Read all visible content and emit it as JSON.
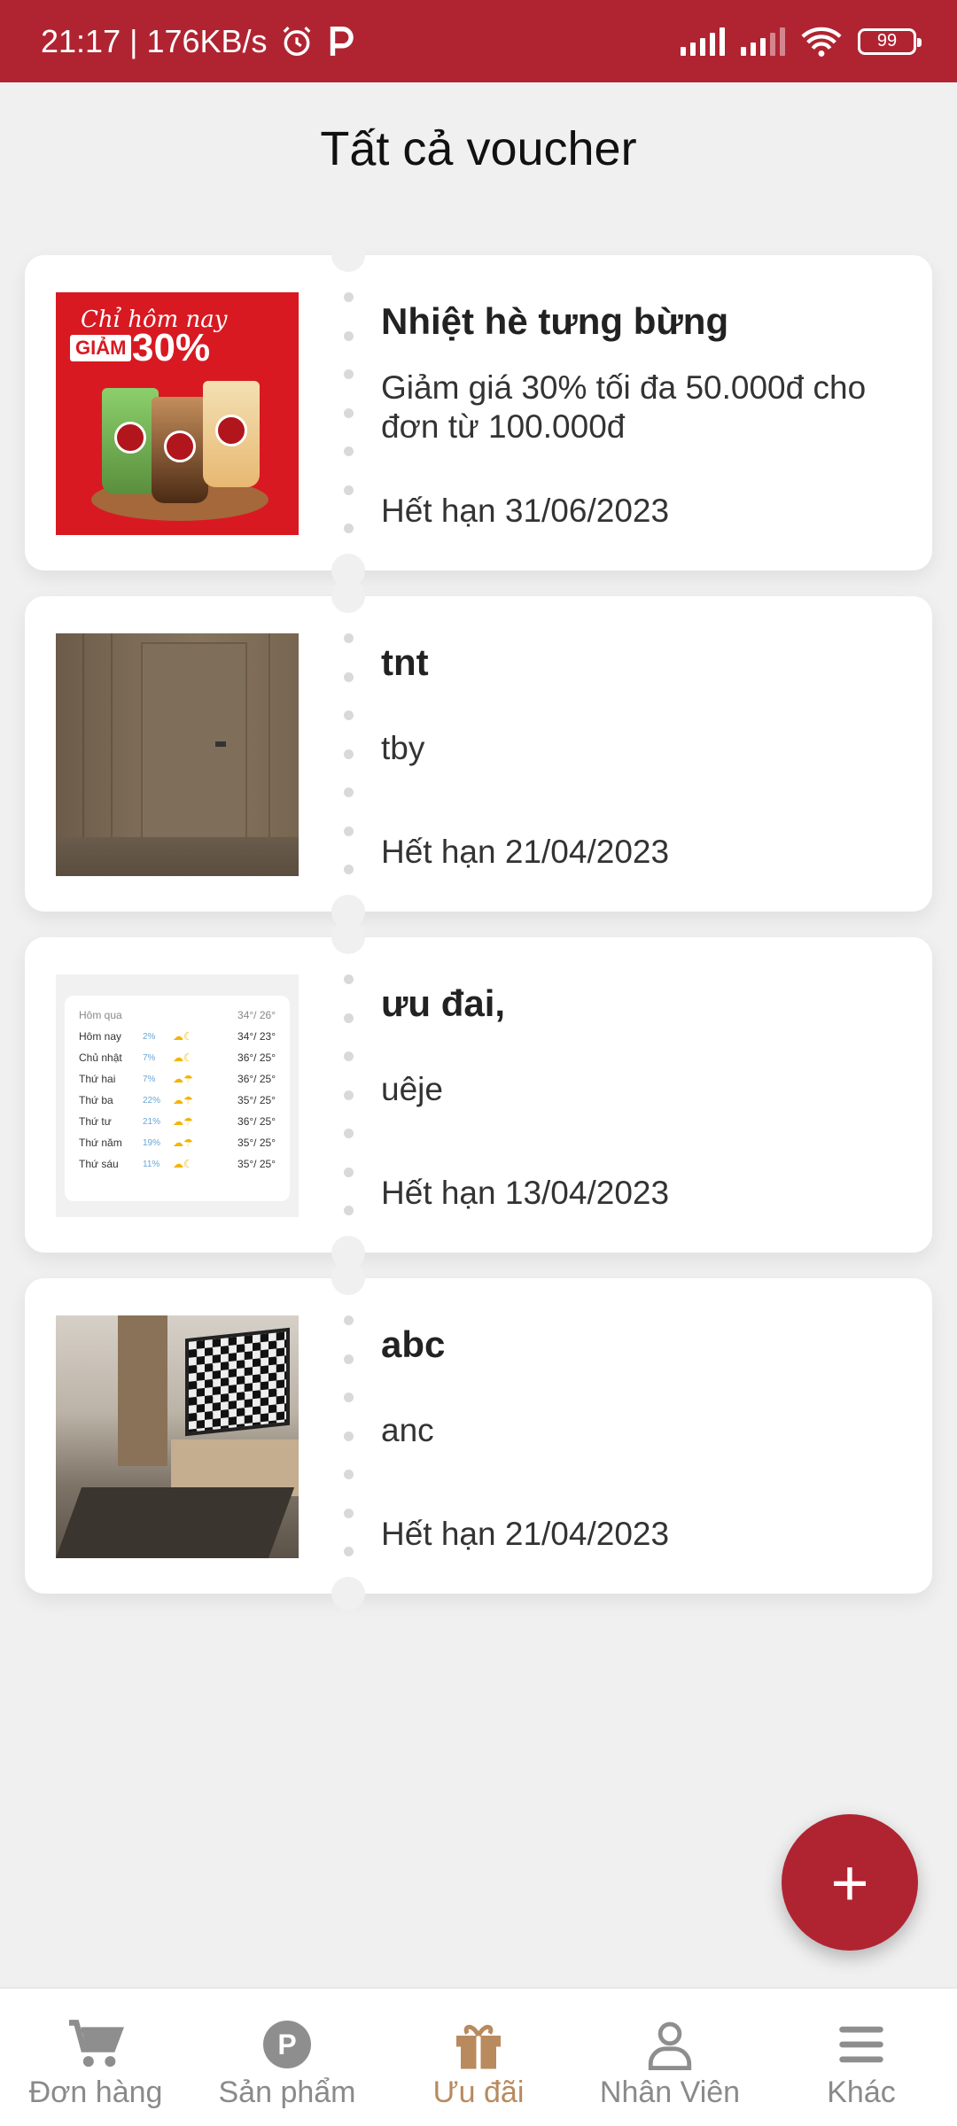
{
  "status_bar": {
    "time_speed": "21:17 | 176KB/s",
    "battery": "99"
  },
  "page": {
    "title": "Tất cả voucher"
  },
  "vouchers": [
    {
      "title": "Nhiệt hè tưng bừng",
      "description": "Giảm giá 30% tối đa 50.000đ cho đơn từ 100.000đ",
      "expiry": "Hết hạn 31/06/2023",
      "image_text": {
        "line1": "Chỉ hôm nay",
        "badge": "GIẢM",
        "percent": "30%"
      }
    },
    {
      "title": "tnt",
      "description": "tby",
      "expiry": "Hết hạn 21/04/2023"
    },
    {
      "title": "ưu đai,",
      "description": "uêje",
      "expiry": "Hết hạn 13/04/2023",
      "image_rows": [
        {
          "day": "Hôm qua",
          "pct": "",
          "temp": "34°/ 26°"
        },
        {
          "day": "Hôm nay",
          "pct": "2%",
          "temp": "34°/ 23°"
        },
        {
          "day": "Chủ nhật",
          "pct": "7%",
          "temp": "36°/ 25°"
        },
        {
          "day": "Thứ hai",
          "pct": "7%",
          "temp": "36°/ 25°"
        },
        {
          "day": "Thứ ba",
          "pct": "22%",
          "temp": "35°/ 25°"
        },
        {
          "day": "Thứ tư",
          "pct": "21%",
          "temp": "36°/ 25°"
        },
        {
          "day": "Thứ năm",
          "pct": "19%",
          "temp": "35°/ 25°"
        },
        {
          "day": "Thứ sáu",
          "pct": "11%",
          "temp": "35°/ 25°"
        }
      ]
    },
    {
      "title": "abc",
      "description": "anc",
      "expiry": "Hết hạn 21/04/2023"
    }
  ],
  "fab": {
    "label": "+"
  },
  "bottom_nav": [
    {
      "label": "Đơn hàng",
      "icon": "cart-icon",
      "active": false
    },
    {
      "label": "Sản phẩm",
      "icon": "product-p-icon",
      "active": false
    },
    {
      "label": "Ưu đãi",
      "icon": "gift-icon",
      "active": true
    },
    {
      "label": "Nhân Viên",
      "icon": "person-icon",
      "active": false
    },
    {
      "label": "Khác",
      "icon": "menu-icon",
      "active": false
    }
  ],
  "colors": {
    "primary": "#b02432",
    "active_nav": "#b88a5e",
    "background": "#f0f0f0"
  }
}
